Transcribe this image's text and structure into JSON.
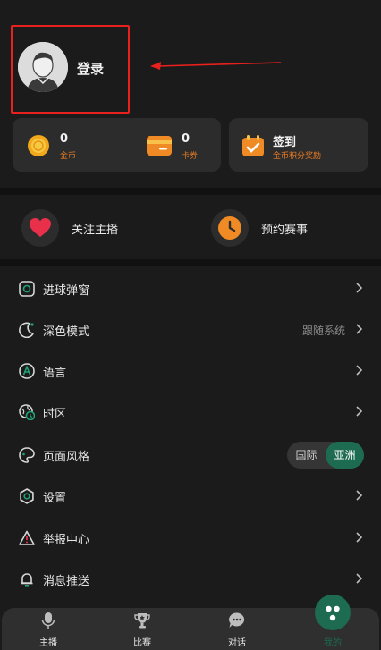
{
  "profile": {
    "login_label": "登录"
  },
  "wallet": {
    "coins_value": "0",
    "coins_label": "金币",
    "cards_value": "0",
    "cards_label": "卡券"
  },
  "signin": {
    "title": "签到",
    "subtitle": "金币积分奖励"
  },
  "quick": {
    "follow_label": "关注主播",
    "reserve_label": "预约赛事"
  },
  "settings": {
    "goal_popup": "进球弹窗",
    "dark_mode": "深色模式",
    "dark_mode_value": "跟随系统",
    "language": "语言",
    "timezone": "时区",
    "page_style": "页面风格",
    "style_option_intl": "国际",
    "style_option_asia": "亚洲",
    "settings": "设置",
    "report": "举报中心",
    "push": "消息推送"
  },
  "tabs": {
    "host": "主播",
    "match": "比赛",
    "chat": "对话",
    "mine": "我的"
  },
  "colors": {
    "accent": "#1d6b51",
    "highlight_border": "#e8201e",
    "orange": "#e77b25"
  },
  "icons": [
    "avatar",
    "coin-icon",
    "card-icon",
    "calendar-check-icon",
    "heart-icon",
    "clock-icon",
    "goal-popup-icon",
    "moon-icon",
    "language-icon",
    "timezone-icon",
    "palette-icon",
    "gear-icon",
    "warning-icon",
    "bell-icon",
    "mic-icon",
    "trophy-icon",
    "chat-icon"
  ]
}
